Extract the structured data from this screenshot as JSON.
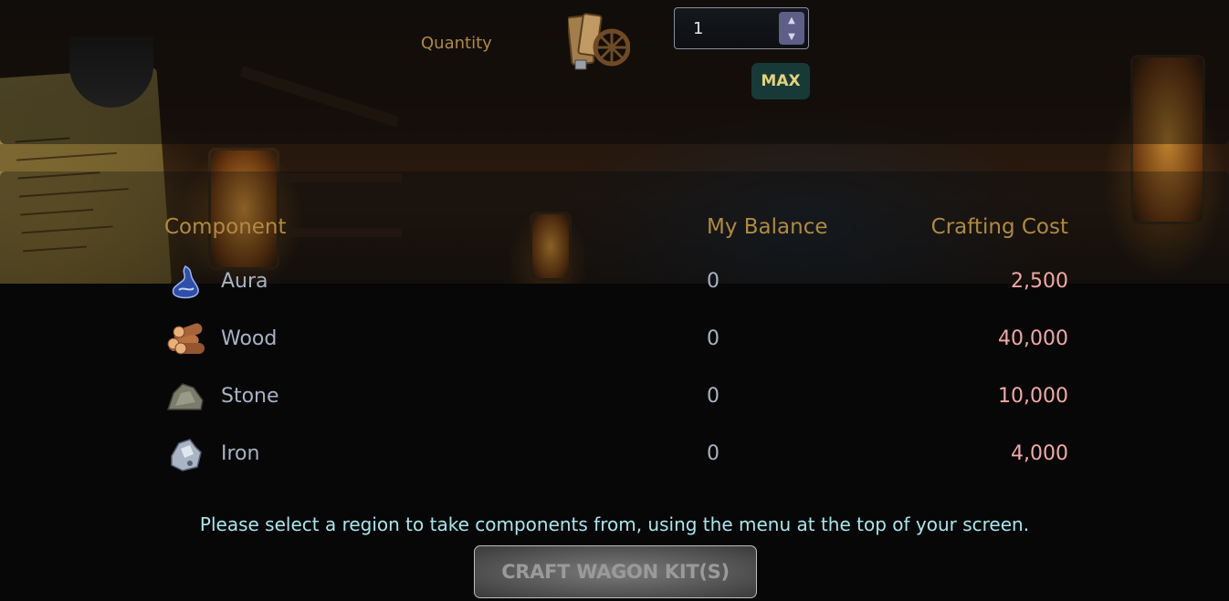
{
  "quantity": {
    "label": "Quantity",
    "value": "1",
    "max_label": "MAX",
    "item_icon": "wagon-kit-icon"
  },
  "table": {
    "headers": {
      "component": "Component",
      "balance": "My Balance",
      "cost": "Crafting Cost"
    },
    "rows": [
      {
        "icon": "aura-icon",
        "name": "Aura",
        "balance": "0",
        "cost": "2,500"
      },
      {
        "icon": "wood-icon",
        "name": "Wood",
        "balance": "0",
        "cost": "40,000"
      },
      {
        "icon": "stone-icon",
        "name": "Stone",
        "balance": "0",
        "cost": "10,000"
      },
      {
        "icon": "iron-icon",
        "name": "Iron",
        "balance": "0",
        "cost": "4,000"
      }
    ]
  },
  "notice": "Please select a region to take components from, using the menu at the top of your screen.",
  "craft_button": "CRAFT WAGON KIT(S)",
  "colors": {
    "header_gold": "#b08a3e",
    "cost_pink": "#f0a9a6",
    "notice_cyan": "#a9e6ee",
    "max_bg": "#173a38"
  }
}
